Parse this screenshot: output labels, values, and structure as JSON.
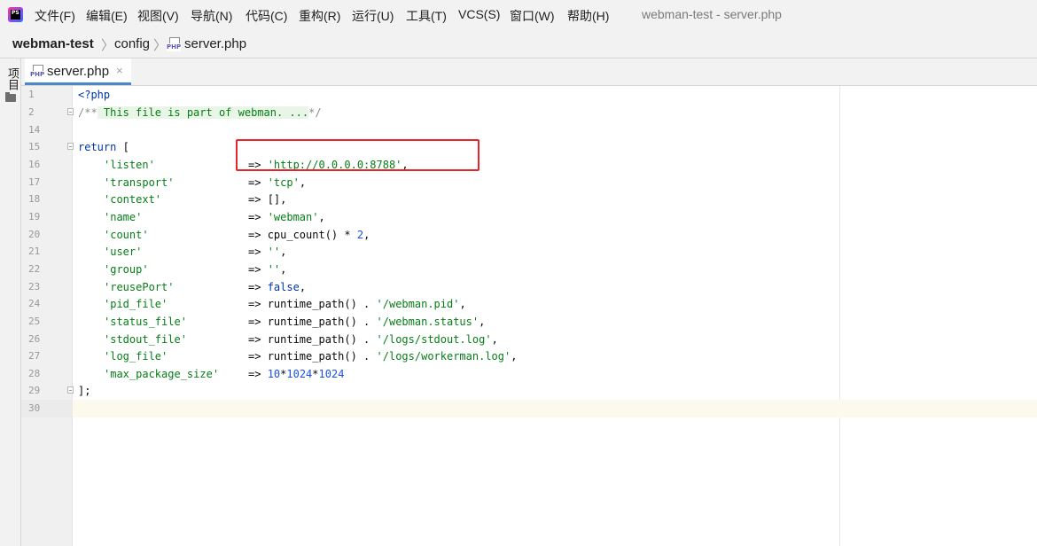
{
  "menu": [
    "文件(F)",
    "编辑(E)",
    "视图(V)",
    "导航(N)",
    "代码(C)",
    "重构(R)",
    "运行(U)",
    "工具(T)",
    "VCS(S)",
    "窗口(W)",
    "帮助(H)"
  ],
  "window_title": "webman-test - server.php",
  "app_icon_label": "PS",
  "breadcrumbs": {
    "project": "webman-test",
    "folder": "config",
    "file": "server.php"
  },
  "side_panel_label": "项目",
  "tab": {
    "label": "server.php",
    "close": "×"
  },
  "file_icon_label": "PHP",
  "lines": {
    "l1": {
      "num": "1",
      "open": "<?php"
    },
    "l2": {
      "num": "2",
      "start": "/**",
      "folded": " This file is part of webman. ...",
      "end": "*/"
    },
    "l14": {
      "num": "14"
    },
    "l15": {
      "num": "15",
      "kw": "return",
      "bracket": " ["
    },
    "l16": {
      "num": "16",
      "key": "'listen'",
      "arrow": "=> ",
      "val": "'http://0.0.0.0:8788'",
      "tail": ","
    },
    "l17": {
      "num": "17",
      "key": "'transport'",
      "arrow": "=> ",
      "val": "'tcp'",
      "tail": ","
    },
    "l18": {
      "num": "18",
      "key": "'context'",
      "arrow": "=> ",
      "plain": "[],"
    },
    "l19": {
      "num": "19",
      "key": "'name'",
      "arrow": "=> ",
      "val": "'webman'",
      "tail": ","
    },
    "l20": {
      "num": "20",
      "key": "'count'",
      "arrow": "=> ",
      "plain": "cpu_count() * ",
      "n": "2",
      "tail": ","
    },
    "l21": {
      "num": "21",
      "key": "'user'",
      "arrow": "=> ",
      "val": "''",
      "tail": ","
    },
    "l22": {
      "num": "22",
      "key": "'group'",
      "arrow": "=> ",
      "val": "''",
      "tail": ","
    },
    "l23": {
      "num": "23",
      "key": "'reusePort'",
      "arrow": "=> ",
      "kwv": "false",
      "tail": ","
    },
    "l24": {
      "num": "24",
      "key": "'pid_file'",
      "arrow": "=> ",
      "plain": "runtime_path() . ",
      "val": "'/webman.pid'",
      "tail": ","
    },
    "l25": {
      "num": "25",
      "key": "'status_file'",
      "arrow": "=> ",
      "plain": "runtime_path() . ",
      "val": "'/webman.status'",
      "tail": ","
    },
    "l26": {
      "num": "26",
      "key": "'stdout_file'",
      "arrow": "=> ",
      "plain": "runtime_path() . ",
      "val": "'/logs/stdout.log'",
      "tail": ","
    },
    "l27": {
      "num": "27",
      "key": "'log_file'",
      "arrow": "=> ",
      "plain": "runtime_path() . ",
      "val": "'/logs/workerman.log'",
      "tail": ","
    },
    "l28": {
      "num": "28",
      "key": "'max_package_size'",
      "arrow": "=> ",
      "n1": "10",
      "op1": "*",
      "n2": "1024",
      "op2": "*",
      "n3": "1024"
    },
    "l29": {
      "num": "29",
      "close": "];"
    },
    "l30": {
      "num": "30"
    }
  },
  "colors": {
    "keyword": "#0033b3",
    "string": "#067d17",
    "number": "#1750eb",
    "highlight_box": "#e8262a",
    "tab_accent": "#4a88c7"
  }
}
